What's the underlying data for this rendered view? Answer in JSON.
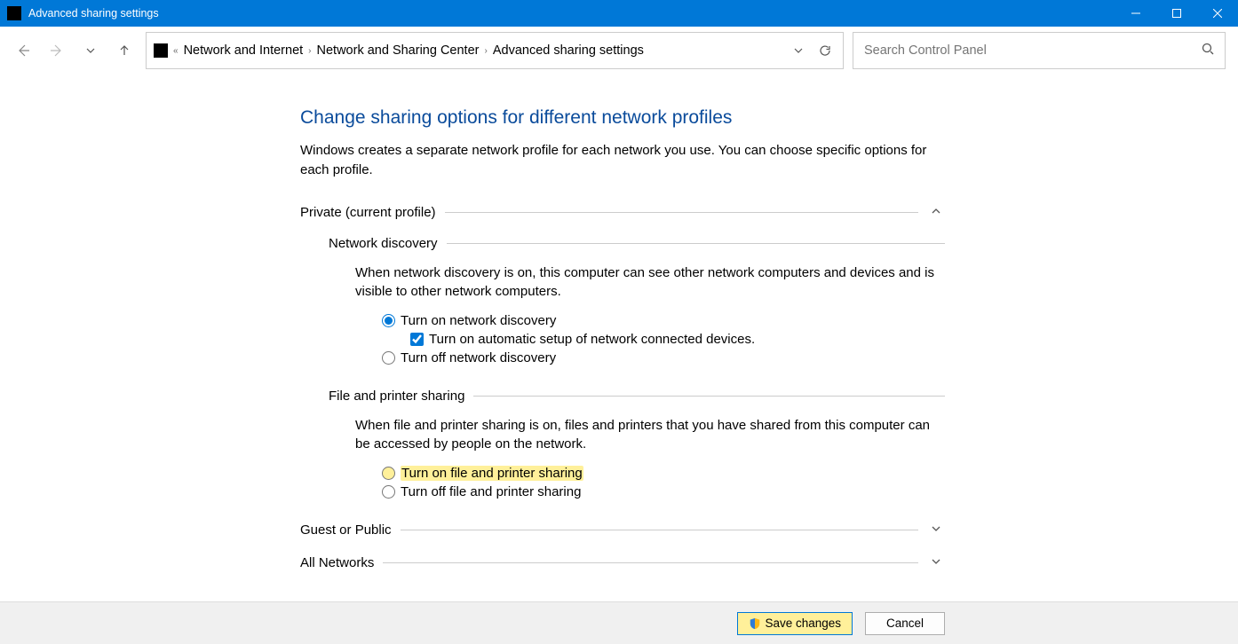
{
  "window": {
    "title": "Advanced sharing settings"
  },
  "breadcrumb": {
    "item1": "Network and Internet",
    "item2": "Network and Sharing Center",
    "item3": "Advanced sharing settings"
  },
  "search": {
    "placeholder": "Search Control Panel"
  },
  "page": {
    "heading": "Change sharing options for different network profiles",
    "intro": "Windows creates a separate network profile for each network you use. You can choose specific options for each profile."
  },
  "sections": {
    "private": {
      "title": "Private (current profile)",
      "network_discovery": {
        "title": "Network discovery",
        "desc": "When network discovery is on, this computer can see other network computers and devices and is visible to other network computers.",
        "opt_on": "Turn on network discovery",
        "opt_auto": "Turn on automatic setup of network connected devices.",
        "opt_off": "Turn off network discovery"
      },
      "file_printer": {
        "title": "File and printer sharing",
        "desc": "When file and printer sharing is on, files and printers that you have shared from this computer can be accessed by people on the network.",
        "opt_on": "Turn on file and printer sharing",
        "opt_off": "Turn off file and printer sharing"
      }
    },
    "guest": {
      "title": "Guest or Public"
    },
    "all": {
      "title": "All Networks"
    }
  },
  "buttons": {
    "save": "Save changes",
    "cancel": "Cancel"
  }
}
